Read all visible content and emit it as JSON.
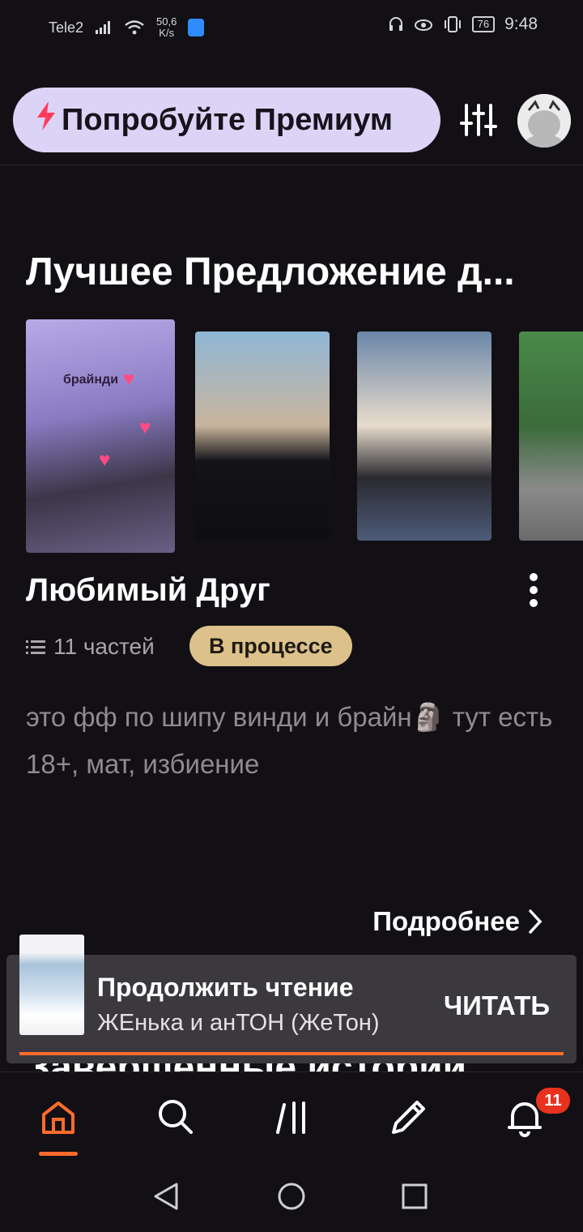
{
  "status_bar": {
    "carrier": "Tele2",
    "speed_value": "50,6",
    "speed_unit": "K/s",
    "battery": "76",
    "time": "9:48"
  },
  "header": {
    "premium_label": "Попробуйте Премиум",
    "icons": [
      "bolt-icon",
      "filter-icon",
      "avatar"
    ]
  },
  "section": {
    "title": "Лучшее Предложение д..."
  },
  "covers": [
    {
      "caption": "брайнди"
    },
    {},
    {},
    {}
  ],
  "story": {
    "title": "Любимый Друг",
    "parts": "11 частей",
    "status": "В процессе",
    "description": "это фф по шипу винди и брайн🗿 тут есть 18+, мат, избиение",
    "details_link": "Подробнее"
  },
  "next_section": {
    "title_partial": "Завершенные истории"
  },
  "continue_reading": {
    "title": "Продолжить чтение",
    "story": "ЖЕнька и анТОН (ЖеТон)",
    "button": "ЧИТАТЬ",
    "progress": 1.0
  },
  "bottom_nav": {
    "items": [
      "home",
      "search",
      "library",
      "write",
      "notifications"
    ],
    "active": "home",
    "notification_count": "11"
  },
  "colors": {
    "background": "#121014",
    "accent": "#ff6b2c",
    "premium_bg": "#dcd4f6",
    "badge_bg": "#dcc18a",
    "notification": "#e8321f"
  }
}
